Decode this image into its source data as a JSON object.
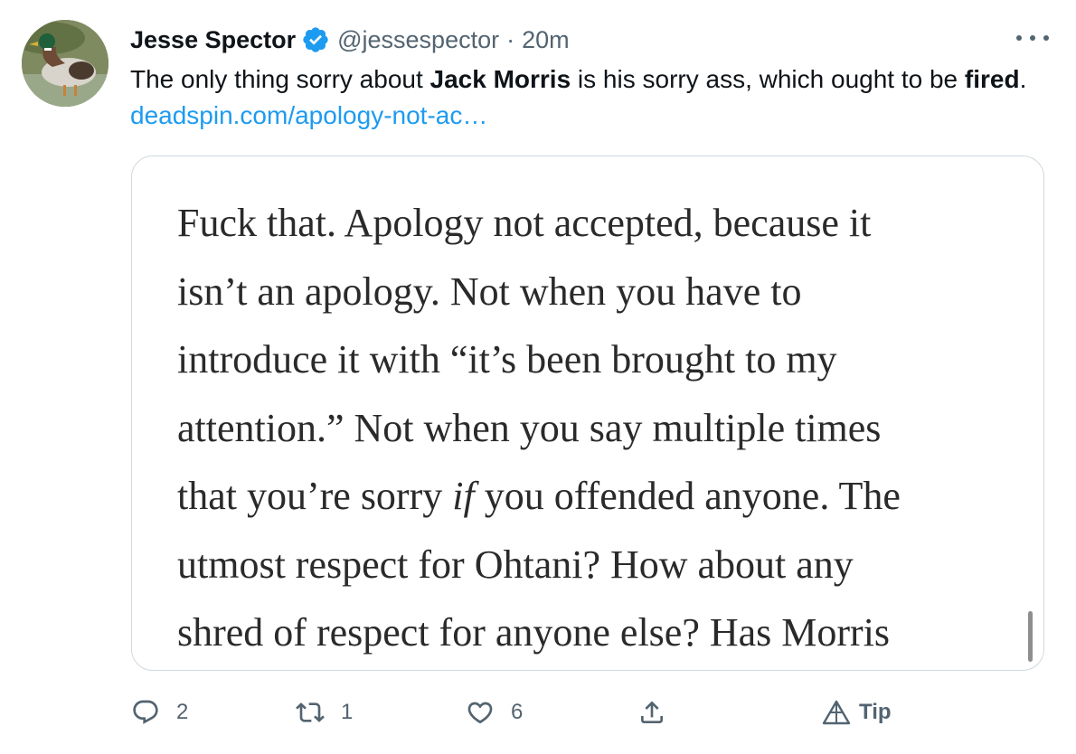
{
  "author": {
    "display_name": "Jesse Spector",
    "handle": "@jessespector",
    "separator": "·",
    "time": "20m"
  },
  "tweet": {
    "text_part1": "The only thing sorry about ",
    "text_bold1": "Jack Morris",
    "text_part2": " is his sorry ass, which ought to be ",
    "text_bold2": "fired",
    "text_part3": ". ",
    "link": "deadspin.com/apology-not-ac…"
  },
  "media": {
    "lines": [
      "Fuck that. Apology not accepted, because it",
      "isn’t an apology. Not when you have to",
      "introduce it with “it’s been brought to my",
      "attention.” Not when you say multiple times"
    ],
    "line5_before": "that you’re sorry ",
    "line5_italic": "if",
    "line5_after": " you offended anyone. The",
    "lines_after": [
      "utmost respect for Ohtani? How about any",
      "shred of respect for anyone else? Has Morris"
    ]
  },
  "actions": {
    "reply_count": "2",
    "retweet_count": "1",
    "like_count": "6",
    "tip_label": "Tip"
  },
  "colors": {
    "link": "#1d9bf0",
    "secondary_text": "#536471",
    "verified": "#1d9bf0",
    "border": "#cfd9de"
  },
  "icons": {
    "verified": "verified-badge-icon",
    "more": "more-options-icon",
    "reply": "reply-icon",
    "retweet": "retweet-icon",
    "like": "heart-icon",
    "share": "share-icon",
    "tip": "tip-icon"
  }
}
